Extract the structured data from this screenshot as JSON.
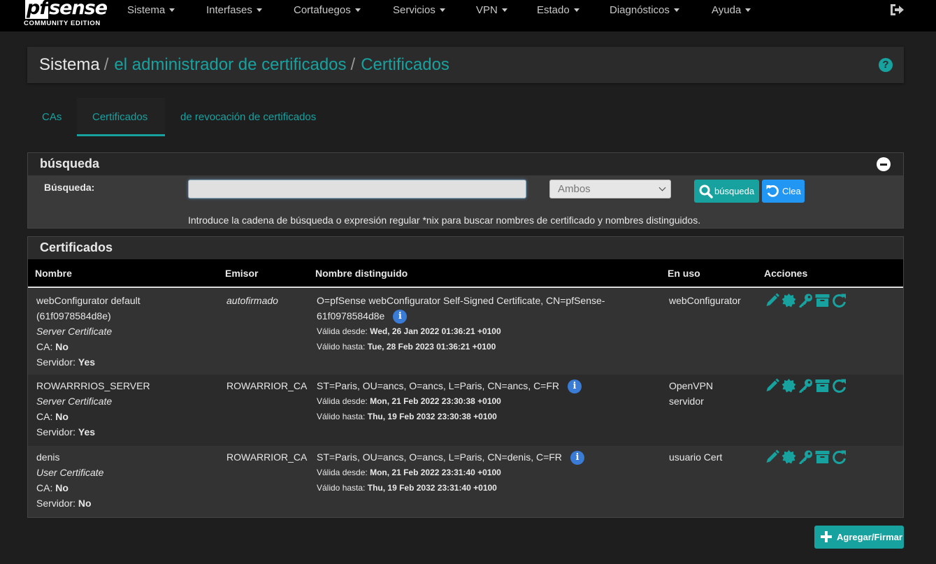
{
  "nav": {
    "logo_main": "pfsense",
    "logo_pf": "pf",
    "logo_rest": "sense",
    "logo_sub": "COMMUNITY EDITION",
    "items": [
      "Sistema",
      "Interfases",
      "Cortafuegos",
      "Servicios",
      "VPN",
      "Estado",
      "Diagnósticos",
      "Ayuda"
    ]
  },
  "breadcrumb": {
    "root": "Sistema",
    "separator": "/",
    "level1": "el administrador de certificados",
    "level2": "Certificados"
  },
  "tabs": [
    "CAs",
    "Certificados",
    "de revocación de certificados"
  ],
  "active_tab": "Certificados",
  "search_panel": {
    "title": "búsqueda",
    "label": "Búsqueda:",
    "input_value": "",
    "select_value": "Ambos",
    "search_button": "búsqueda",
    "clear_button": "Clea",
    "help_text": "Introduce la cadena de búsqueda o expresión regular *nix para buscar nombres de certificado y nombres distinguidos."
  },
  "cert_panel": {
    "title": "Certificados",
    "columns": [
      "Nombre",
      "Emisor",
      "Nombre distinguido",
      "En uso",
      "Acciones"
    ],
    "rows": [
      {
        "name": "webConfigurator default",
        "name_id": "(61f0978584d8e)",
        "type": "Server Certificate",
        "ca_label": "CA:",
        "ca_value": "No",
        "server_label": "Servidor:",
        "server_value": "Yes",
        "issuer": "autofirmado",
        "dn_line1": "O=pfSense webConfigurator Self-Signed Certificate, CN=pfSense-",
        "dn_line2": "61f0978584d8e",
        "valid_from_label": "Válida desde:",
        "valid_from": "Wed, 26 Jan 2022 01:36:21 +0100",
        "valid_to_label": "Válido hasta:",
        "valid_to": "Tue, 28 Feb 2023 01:36:21 +0100",
        "in_use_1": "webConfigurator",
        "in_use_2": ""
      },
      {
        "name": "ROWARRRIOS_SERVER",
        "name_id": "",
        "type": "Server Certificate",
        "ca_label": "CA:",
        "ca_value": "No",
        "server_label": "Servidor:",
        "server_value": "Yes",
        "issuer": "ROWARRIOR_CA",
        "dn_line1": "ST=Paris, OU=ancs, O=ancs, L=Paris, CN=ancs, C=FR",
        "dn_line2": "",
        "valid_from_label": "Válida desde:",
        "valid_from": "Mon, 21 Feb 2022 23:30:38 +0100",
        "valid_to_label": "Válido hasta:",
        "valid_to": "Thu, 19 Feb 2032 23:30:38 +0100",
        "in_use_1": "OpenVPN",
        "in_use_2": "servidor"
      },
      {
        "name": "denis",
        "name_id": "",
        "type": "User Certificate",
        "ca_label": "CA:",
        "ca_value": "No",
        "server_label": "Servidor:",
        "server_value": "No",
        "issuer": "ROWARRIOR_CA",
        "dn_line1": "ST=Paris, OU=ancs, O=ancs, L=Paris, CN=denis, C=FR",
        "dn_line2": "",
        "valid_from_label": "Válida desde:",
        "valid_from": "Mon, 21 Feb 2022 23:31:40 +0100",
        "valid_to_label": "Válido hasta:",
        "valid_to": "Thu, 19 Feb 2032 23:31:40 +0100",
        "in_use_1": "usuario Cert",
        "in_use_2": ""
      }
    ],
    "info_icon": "i"
  },
  "add_button": "Agregar/Firmar",
  "colors": {
    "accent": "#17a2a0",
    "info": "#3a7bd5",
    "clear": "#2196f3",
    "navbar": "#000000",
    "background": "#1e1e1e"
  },
  "icons": [
    "sign-out-icon",
    "question-circle-icon",
    "minus-circle-icon",
    "search-icon",
    "undo-icon",
    "info-icon",
    "pencil-icon",
    "certificate-icon",
    "key-icon",
    "archive-icon",
    "refresh-icon",
    "plus-icon"
  ]
}
